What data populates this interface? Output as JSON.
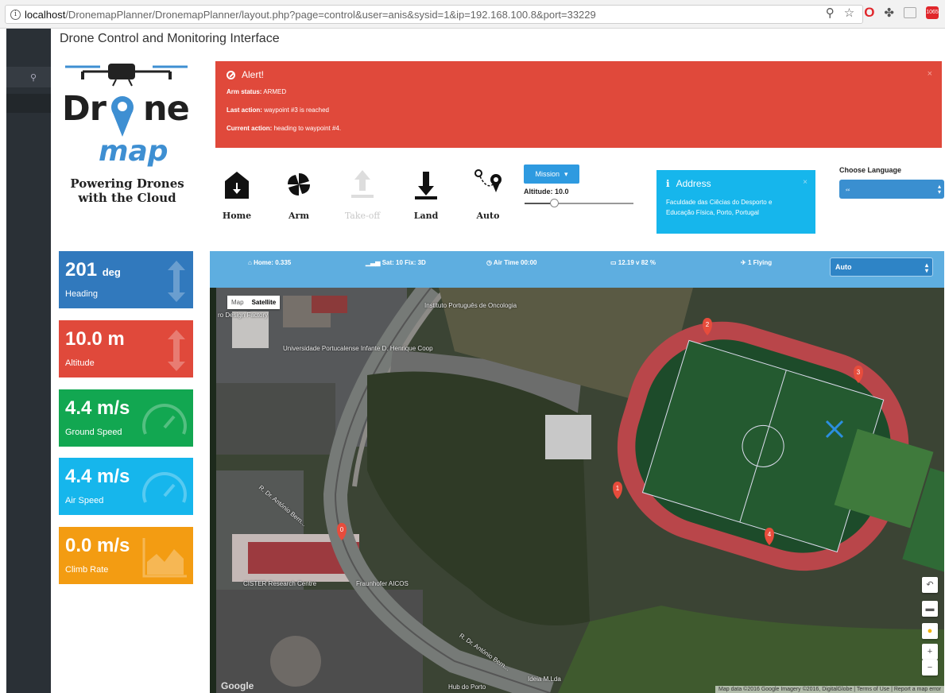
{
  "browser": {
    "url_host": "localhost",
    "url_path": "/DronemapPlanner/DronemapPlanner/layout.php?page=control&user=anis&sysid=1&ip=192.168.100.8&port=33229",
    "ext_badge": "1065"
  },
  "page": {
    "title": "Drone Control and Monitoring Interface"
  },
  "logo": {
    "word_left": "Dr",
    "word_right": "ne",
    "word_map": "map",
    "tagline_1": "Powering Drones",
    "tagline_2": "with the Cloud"
  },
  "alert": {
    "title": "Alert!",
    "arm_label": "Arm status:",
    "arm_value": "ARMED",
    "last_label": "Last action:",
    "last_value": "waypoint #3 is reached",
    "current_label": "Current action:",
    "current_value": "heading to waypoint #4.",
    "close": "×"
  },
  "controls": {
    "home": "Home",
    "arm": "Arm",
    "takeoff": "Take-off",
    "land": "Land",
    "auto": "Auto"
  },
  "mission": {
    "label": "Mission",
    "altitude_label": "Altitude: 10.0",
    "altitude_fraction": 0.27
  },
  "address": {
    "title": "Address",
    "line1": "Faculdade das Ciêcias do Desporto e",
    "line2": "Educação Física, Porto, Portugal",
    "close": "×"
  },
  "language": {
    "label": "Choose Language",
    "value": ""
  },
  "tiles": [
    {
      "value": "201",
      "unit": "deg",
      "name": "Heading",
      "color": "#3179bd"
    },
    {
      "value": "10.0 m",
      "unit": "",
      "name": "Altitude",
      "color": "#e0493b"
    },
    {
      "value": "4.4 m/s",
      "unit": "",
      "name": "Ground Speed",
      "color": "#12a751"
    },
    {
      "value": "4.4 m/s",
      "unit": "",
      "name": "Air Speed",
      "color": "#16b6ec"
    },
    {
      "value": "0.0 m/s",
      "unit": "",
      "name": "Climb Rate",
      "color": "#f39c12"
    }
  ],
  "status": {
    "home": "Home: 0.335",
    "sat": "Sat: 10 Fix: 3D",
    "air_time": "Air Time 00:00",
    "battery": "12.19 v 82 %",
    "flying": "1 Flying",
    "mode": "Auto"
  },
  "map": {
    "type_map": "Map",
    "type_satellite": "Satellite",
    "labels": {
      "instituto": "Instituto Português de Oncologia",
      "design": "ro Design Factory",
      "univ": "Universidade Portucalense Infante D. Henrique Coop",
      "rua1": "R. Dr. António Bern...",
      "cister": "CISTER Research Centre",
      "fraunhofer": "Fraunhofer AICOS",
      "rua2": "R. Dr. António Bern...",
      "ideia": "Ideia M.Lda",
      "hub": "Hub do Porto"
    },
    "waypoints": [
      "0",
      "1",
      "2",
      "3",
      "4"
    ],
    "google": "Google",
    "attribution": "Map data ©2016 Google Imagery ©2016, DigitalGlobe  |  Terms of Use  |  Report a map error",
    "zoom_in": "+",
    "zoom_out": "−"
  }
}
